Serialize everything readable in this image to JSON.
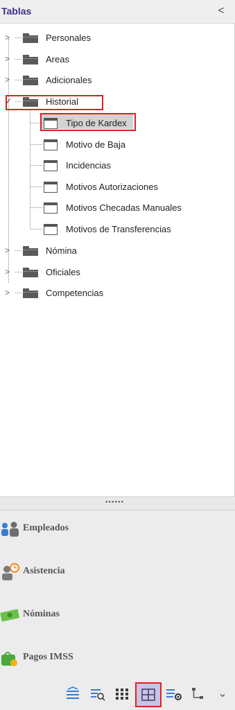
{
  "header": {
    "title": "Tablas",
    "collapse_symbol": "<"
  },
  "tree": {
    "folders": [
      {
        "label": "Personales",
        "expander": ">"
      },
      {
        "label": "Areas",
        "expander": ">"
      },
      {
        "label": "Adicionales",
        "expander": ">"
      },
      {
        "label": "Historial",
        "expander": "✓"
      },
      {
        "label": "Nómina",
        "expander": ">"
      },
      {
        "label": "Oficiales",
        "expander": ">"
      },
      {
        "label": "Competencias",
        "expander": ">"
      }
    ],
    "historial_children": [
      {
        "label": "Tipo de Kardex"
      },
      {
        "label": "Motivo de Baja"
      },
      {
        "label": "Incidencias"
      },
      {
        "label": "Motivos Autorizaciones"
      },
      {
        "label": "Motivos Checadas Manuales"
      },
      {
        "label": "Motivos de Transferencias"
      }
    ]
  },
  "splitter": {
    "grip": "••••••"
  },
  "nav": {
    "items": [
      {
        "label": "Empleados",
        "icon": "people-icon"
      },
      {
        "label": "Asistencia",
        "icon": "attendance-icon"
      },
      {
        "label": "Nóminas",
        "icon": "money-icon"
      },
      {
        "label": "Pagos IMSS",
        "icon": "bag-icon"
      }
    ]
  },
  "toolbar": {
    "icons": [
      "list-icon",
      "search-list-icon",
      "grid-dots-icon",
      "table-grid-icon",
      "grid-settings-icon",
      "hierarchy-icon",
      "chevron-down-icon"
    ],
    "more_symbol": "⌄"
  },
  "colors": {
    "accent": "#3a2f8a",
    "highlight": "#e02020",
    "selected": "#c9c3e4"
  }
}
